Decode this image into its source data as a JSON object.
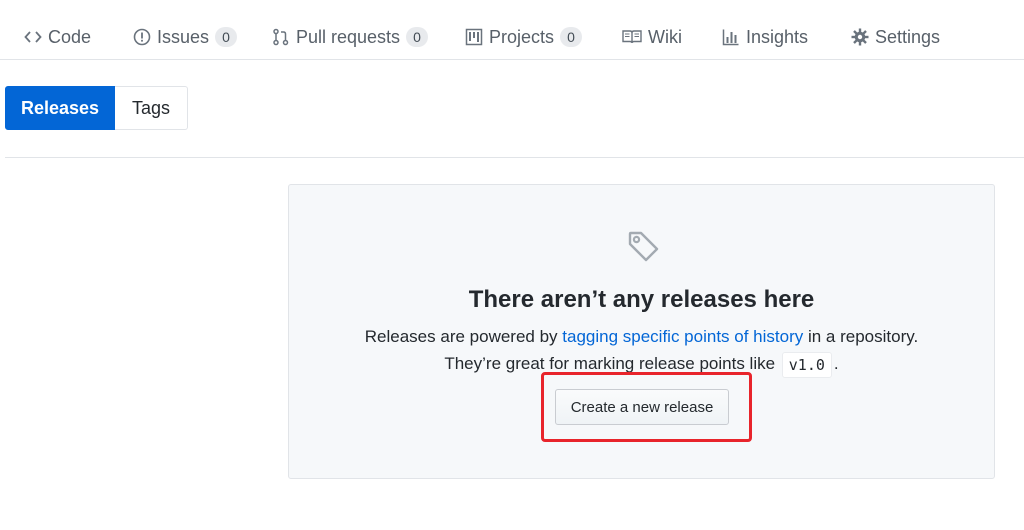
{
  "repo_nav": {
    "code": "Code",
    "issues": "Issues",
    "issues_count": "0",
    "pull_requests": "Pull requests",
    "pull_requests_count": "0",
    "projects": "Projects",
    "projects_count": "0",
    "wiki": "Wiki",
    "insights": "Insights",
    "settings": "Settings"
  },
  "subnav": {
    "releases": "Releases",
    "tags": "Tags",
    "selected": "Releases"
  },
  "blankslate": {
    "title": "There aren’t any releases here",
    "line1_before": "Releases are powered by ",
    "line1_link": "tagging specific points of history",
    "line1_after": " in a repository.",
    "line2_before": "They’re great for marking release points like ",
    "line2_code": "v1.0",
    "line2_after": ".",
    "button": "Create a new release"
  },
  "icons": {
    "code": "code-icon",
    "issues": "issue-opened-icon",
    "pull_requests": "git-pull-request-icon",
    "projects": "project-icon",
    "wiki": "book-icon",
    "insights": "graph-icon",
    "settings": "gear-icon",
    "blankslate": "tag-icon"
  },
  "colors": {
    "accent": "#0366d6",
    "highlight": "#e8242b"
  }
}
